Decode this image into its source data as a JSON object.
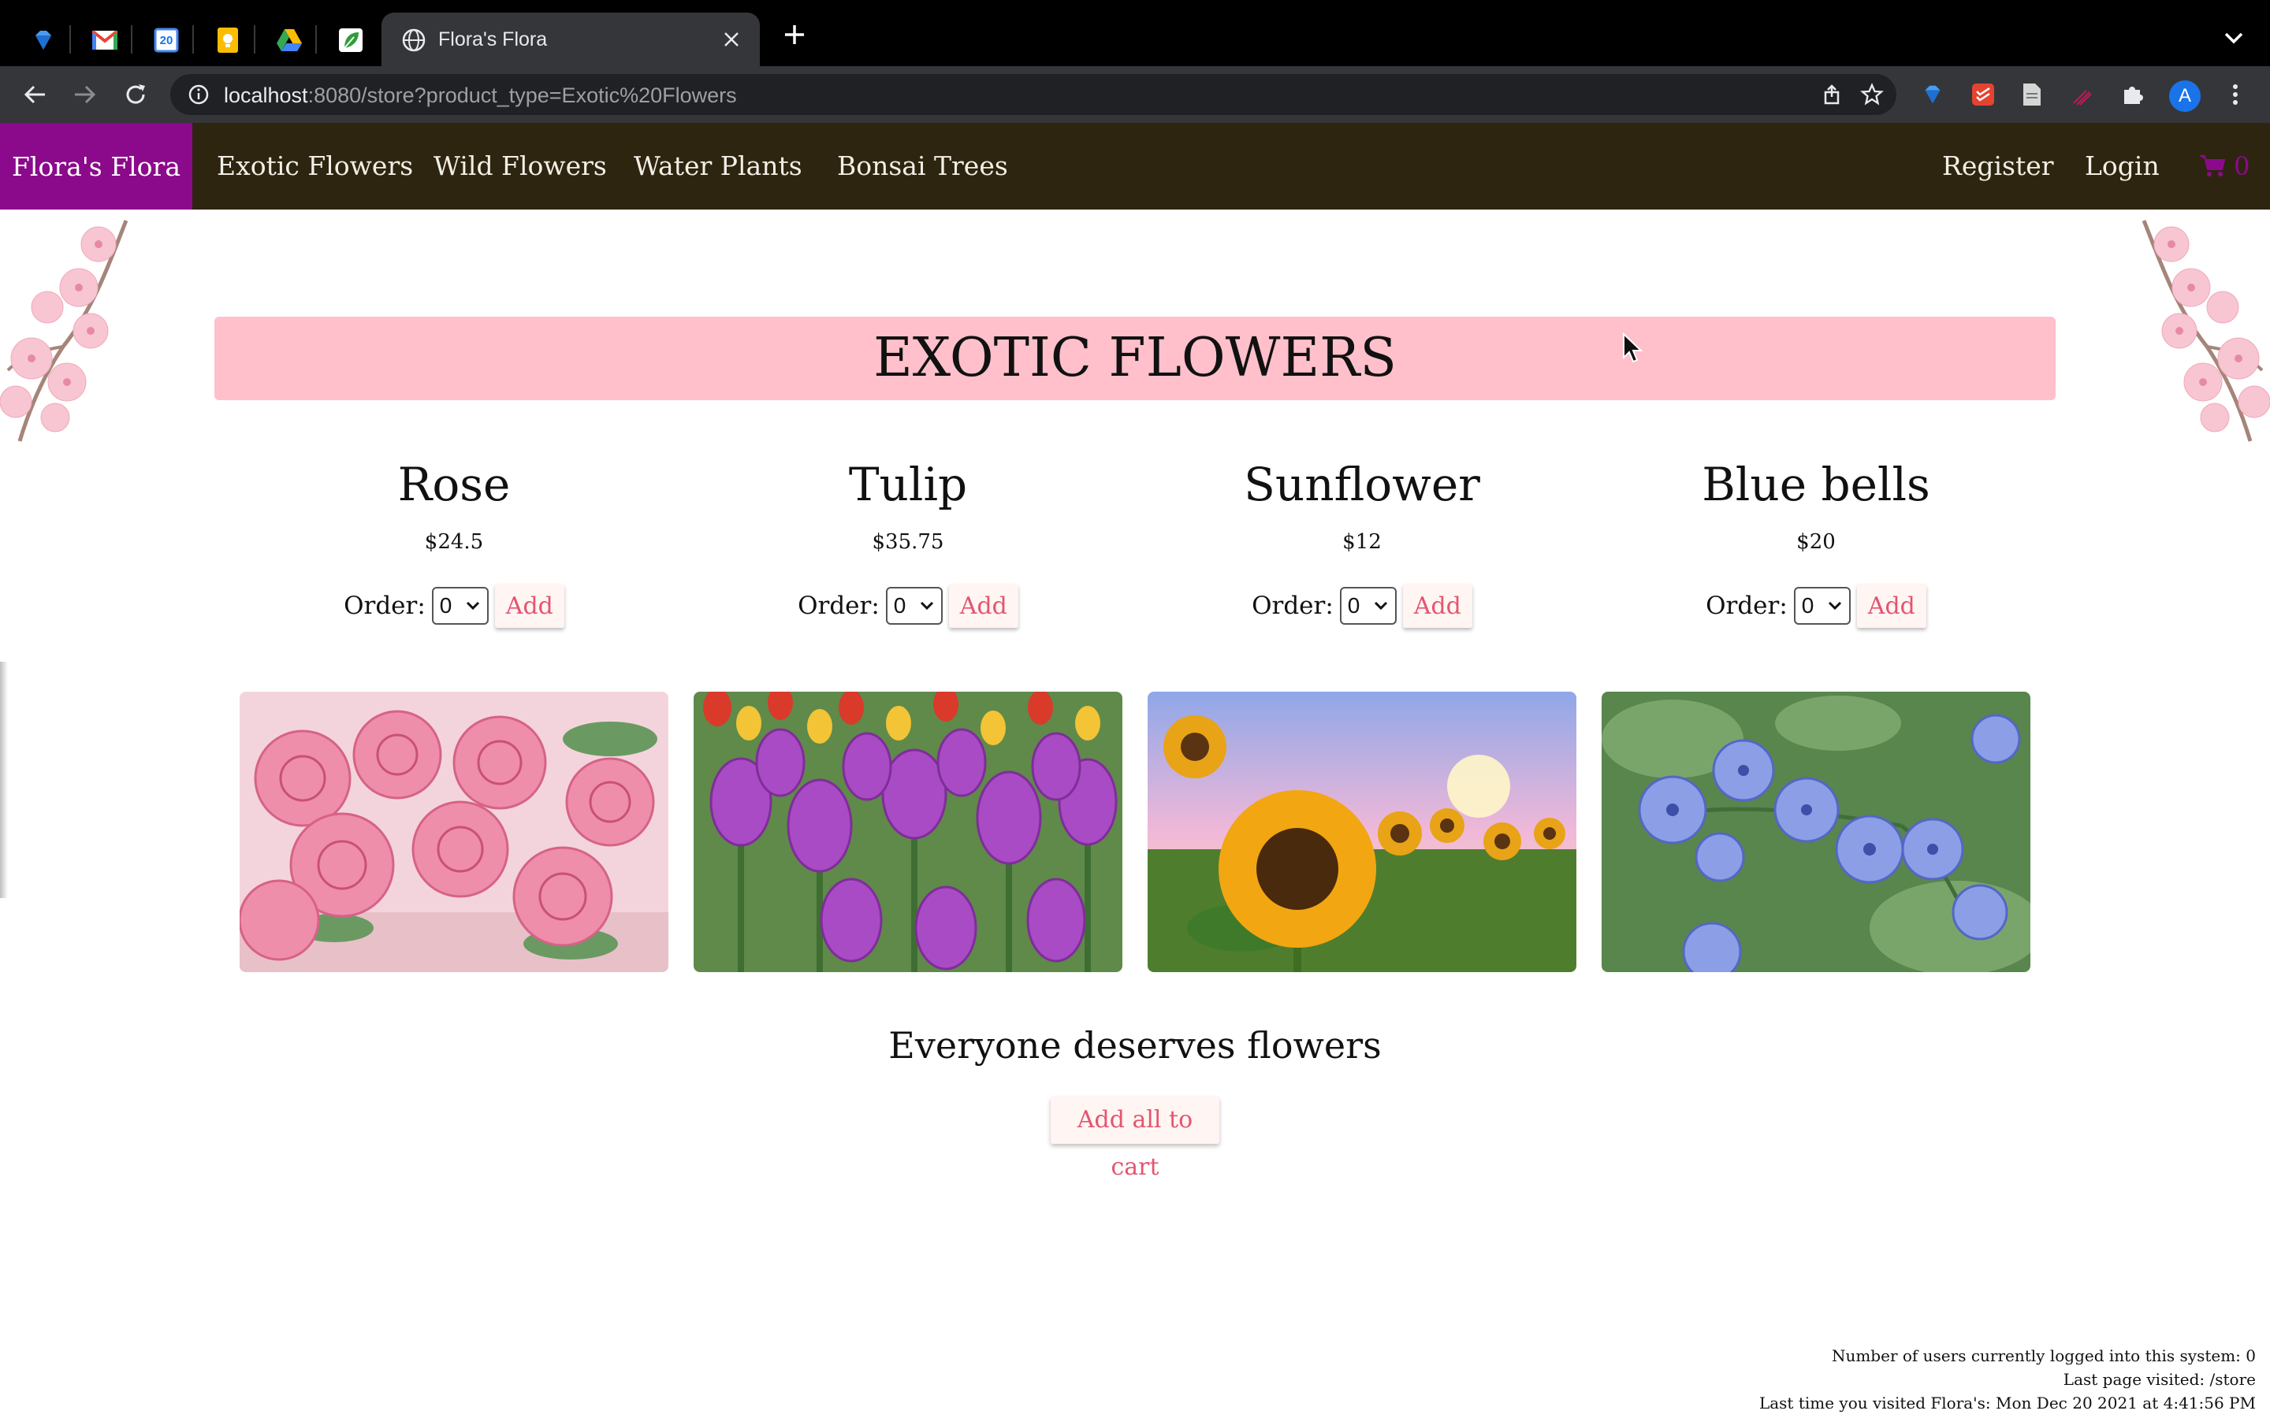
{
  "browser": {
    "pinned_tabs": [
      "gem-icon",
      "gmail-icon",
      "calendar-icon",
      "keep-icon",
      "drive-icon",
      "leaf-icon"
    ],
    "calendar_day": "20",
    "active_tab_title": "Flora's Flora",
    "url_host": "localhost",
    "url_rest": ":8080/store?product_type=Exotic%20Flowers",
    "profile_initial": "A"
  },
  "site": {
    "brand": "Flora's Flora",
    "nav": [
      "Exotic Flowers",
      "Wild Flowers",
      "Water Plants",
      "Bonsai Trees"
    ],
    "register": "Register",
    "login": "Login",
    "cart_count": "0",
    "accent_color": "#8b0a8b",
    "nav_bg_color": "#2e2510",
    "banner_color": "#ffc0cb"
  },
  "page": {
    "heading": "EXOTIC FLOWERS",
    "order_label": "Order:",
    "add_label": "Add",
    "products": [
      {
        "name": "Rose",
        "price": "$24.5",
        "qty": "0"
      },
      {
        "name": "Tulip",
        "price": "$35.75",
        "qty": "0"
      },
      {
        "name": "Sunflower",
        "price": "$12",
        "qty": "0"
      },
      {
        "name": "Blue bells",
        "price": "$20",
        "qty": "0"
      }
    ],
    "tagline": "Everyone deserves flowers",
    "add_all": "Add all to cart"
  },
  "footer": {
    "users": "Number of users currently logged into this system: 0",
    "last_page": "Last page visited: /store",
    "last_time": "Last time you visited Flora's: Mon Dec 20 2021 at 4:41:56 PM"
  }
}
